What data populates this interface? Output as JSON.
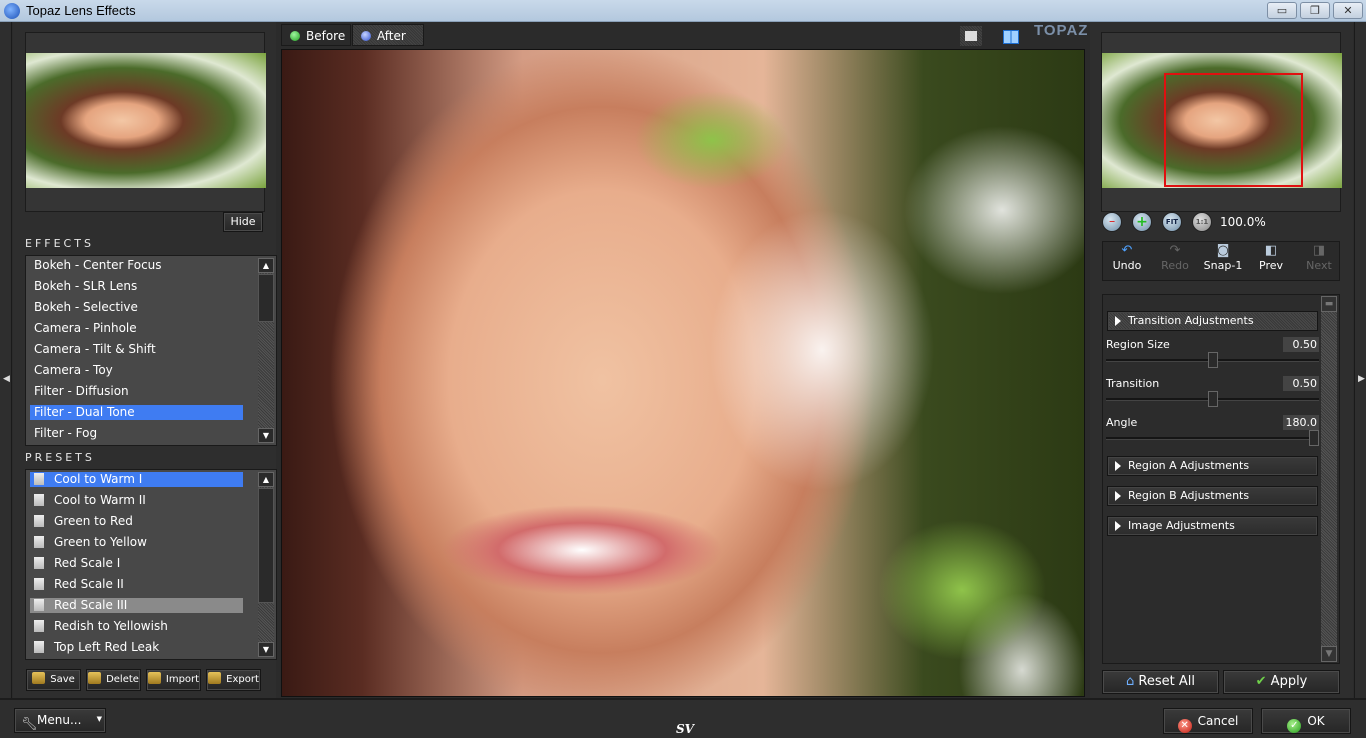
{
  "window": {
    "title": "Topaz Lens Effects",
    "controls": {
      "minimize": "▭",
      "maximize": "❐",
      "close": "✕"
    }
  },
  "left_panel": {
    "hide_label": "Hide",
    "effects_label": "EFFECTS",
    "effects": [
      {
        "label": "Bokeh - Center Focus",
        "selected": false
      },
      {
        "label": "Bokeh - SLR Lens",
        "selected": false
      },
      {
        "label": "Bokeh - Selective",
        "selected": false
      },
      {
        "label": "Camera - Pinhole",
        "selected": false
      },
      {
        "label": "Camera - Tilt & Shift",
        "selected": false
      },
      {
        "label": "Camera - Toy",
        "selected": false
      },
      {
        "label": "Filter - Diffusion",
        "selected": false
      },
      {
        "label": "Filter - Dual Tone",
        "selected": true
      },
      {
        "label": "Filter - Fog",
        "selected": false
      }
    ],
    "presets_label": "PRESETS",
    "presets": [
      {
        "label": "Cool to Warm I",
        "state": "selected"
      },
      {
        "label": "Cool to Warm II",
        "state": ""
      },
      {
        "label": "Green to Red",
        "state": ""
      },
      {
        "label": "Green to Yellow",
        "state": ""
      },
      {
        "label": "Red Scale I",
        "state": ""
      },
      {
        "label": "Red Scale II",
        "state": ""
      },
      {
        "label": "Red Scale III",
        "state": "highlighted"
      },
      {
        "label": "Redish to Yellowish",
        "state": ""
      },
      {
        "label": "Top Left Red Leak",
        "state": ""
      }
    ],
    "preset_buttons": {
      "save": "Save",
      "delete": "Delete",
      "import": "Import",
      "export": "Export"
    }
  },
  "center": {
    "tabs": [
      {
        "label": "Before",
        "dot_color": "#3fcf3f",
        "active": false
      },
      {
        "label": "After",
        "dot_color": "#4d6fe0",
        "active": true
      }
    ],
    "logo_text": "TOPAZ"
  },
  "right_panel": {
    "zoom": {
      "out": "−",
      "in": "+",
      "fit": "FIT",
      "one_to_one": "1:1",
      "level": "100.0%"
    },
    "history": [
      {
        "label": "Undo",
        "icon": "↶",
        "enabled": true
      },
      {
        "label": "Redo",
        "icon": "↷",
        "enabled": false
      },
      {
        "label": "Snap-1",
        "icon": "◙",
        "enabled": true
      },
      {
        "label": "Prev",
        "icon": "◧",
        "enabled": true
      },
      {
        "label": "Next",
        "icon": "◨",
        "enabled": false
      }
    ],
    "sections": {
      "transition": "Transition Adjustments",
      "region_a": "Region A Adjustments",
      "region_b": "Region B Adjustments",
      "image": "Image Adjustments"
    },
    "params": [
      {
        "label": "Region Size",
        "value": "0.50",
        "fraction": 0.5
      },
      {
        "label": "Transition",
        "value": "0.50",
        "fraction": 0.5
      },
      {
        "label": "Angle",
        "value": "180.0",
        "fraction": 1.0
      }
    ],
    "reset_label": "Reset All",
    "apply_label": "Apply"
  },
  "footer": {
    "menu_label": "Menu...",
    "sv_label": "SV",
    "cancel_label": "Cancel",
    "ok_label": "OK"
  }
}
